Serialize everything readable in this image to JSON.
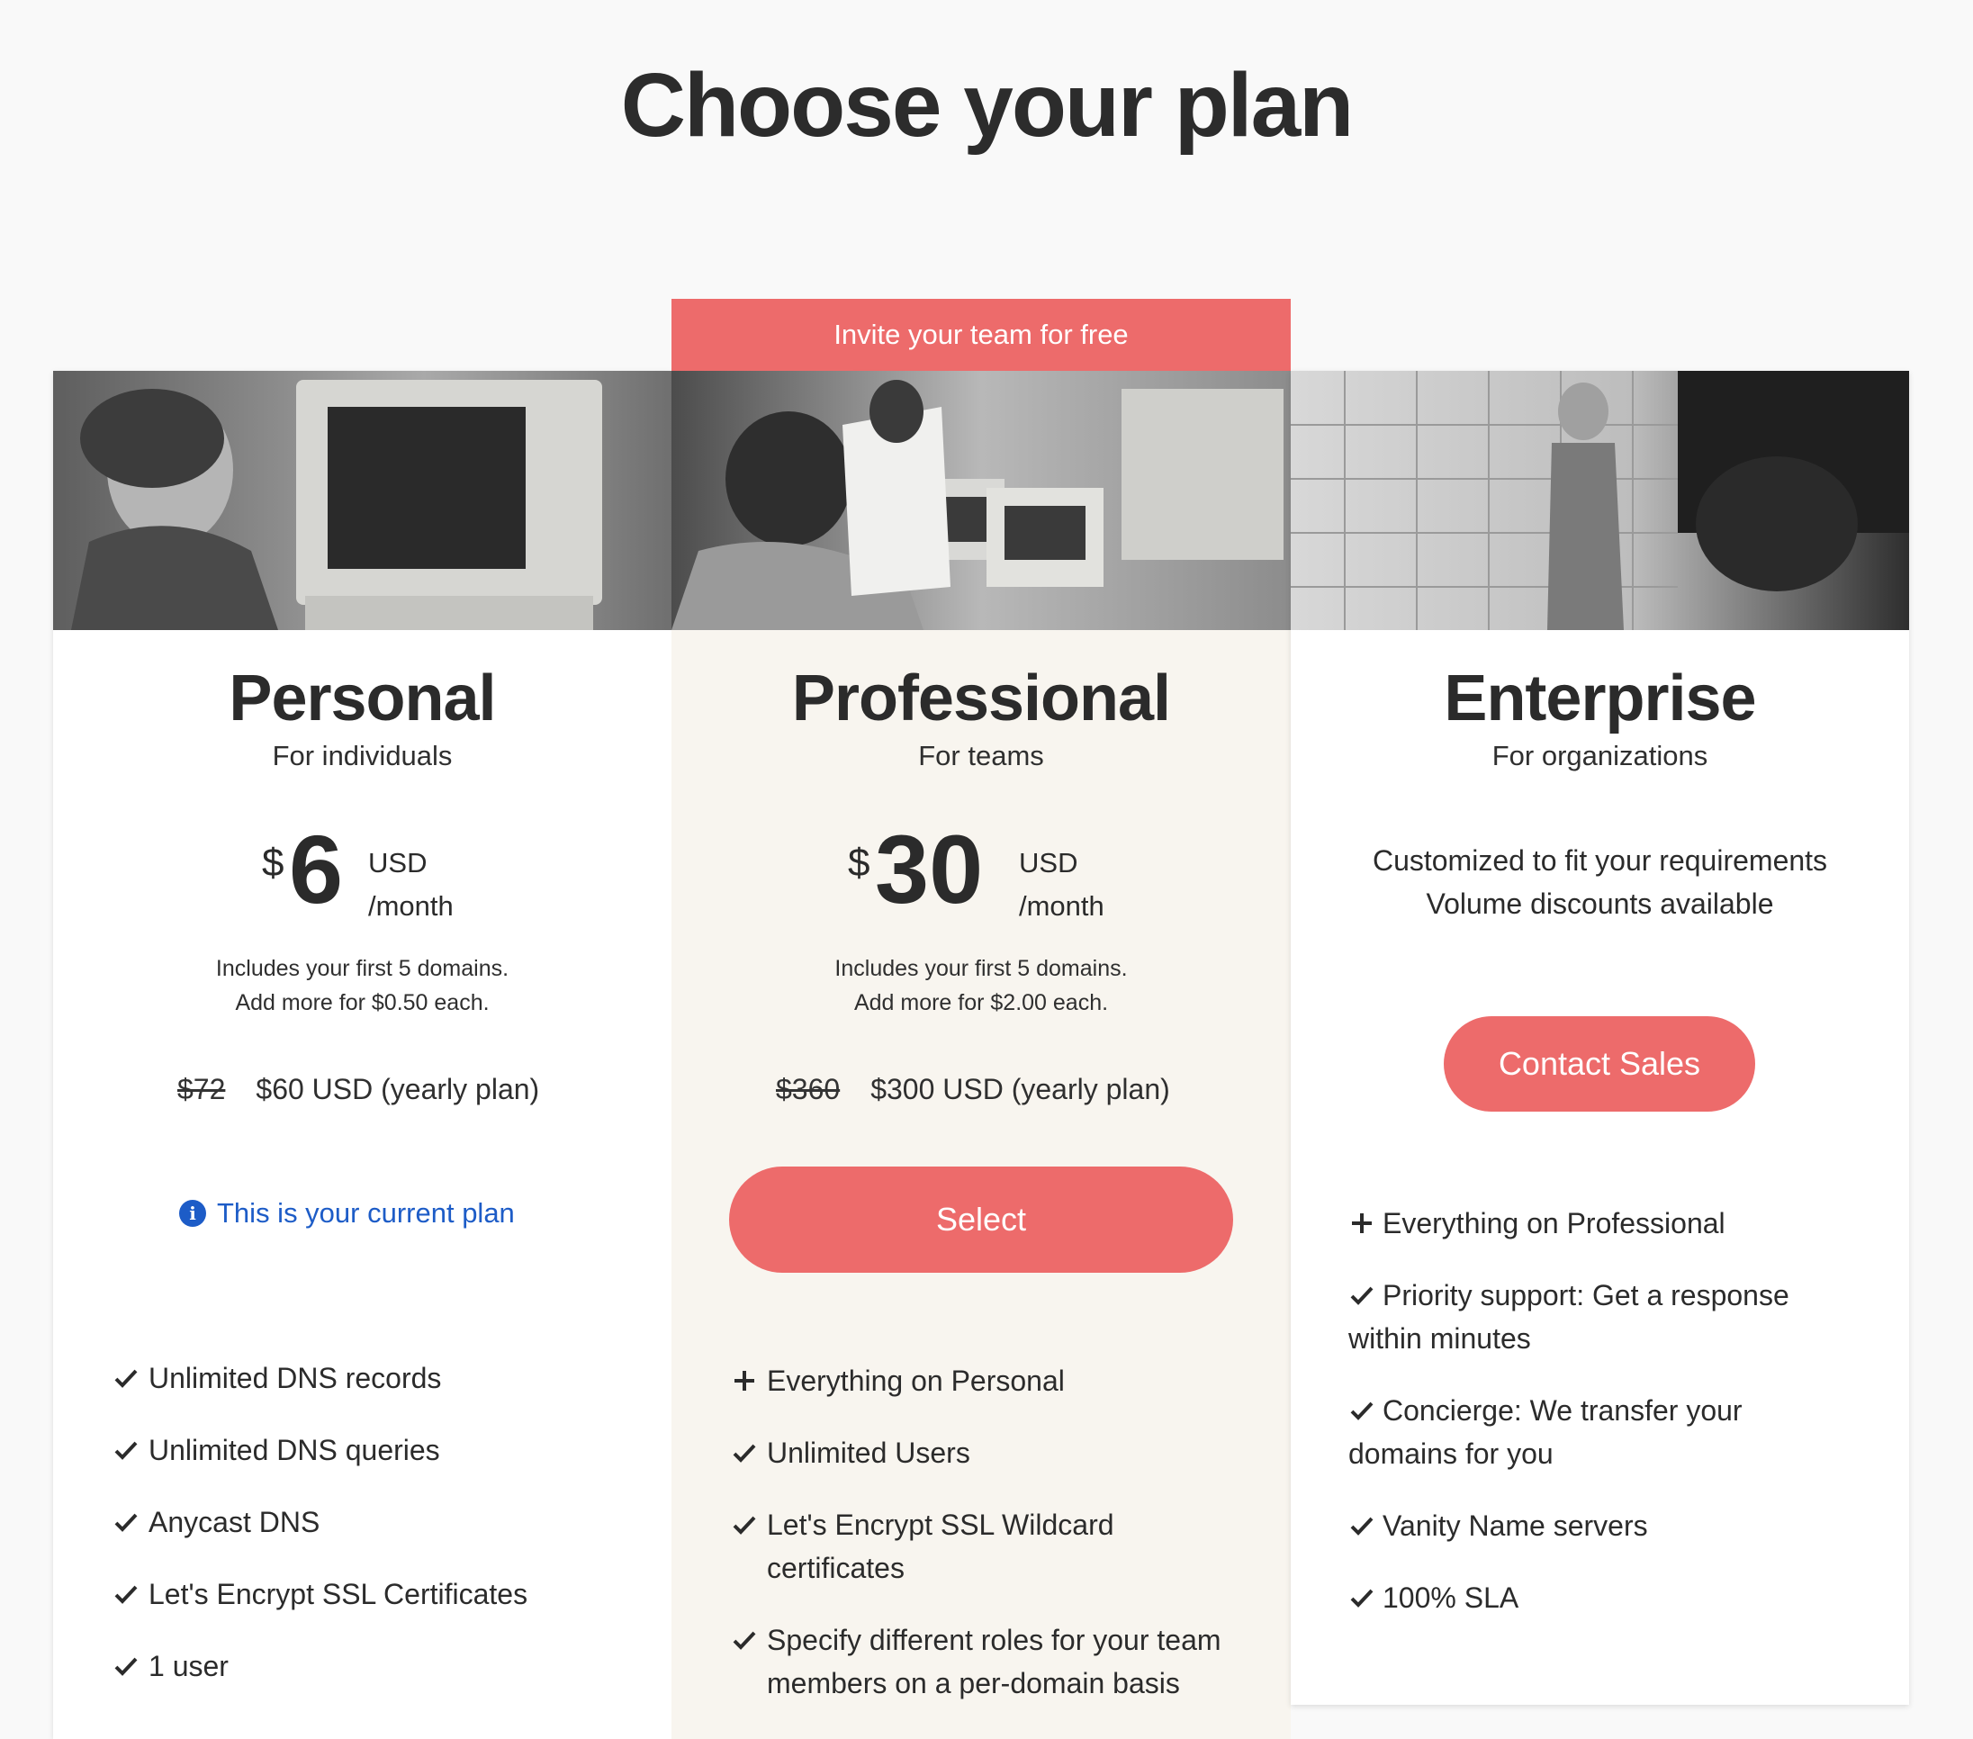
{
  "page": {
    "title": "Choose your plan"
  },
  "banner": {
    "text": "Invite your team for free"
  },
  "plans": {
    "personal": {
      "name": "Personal",
      "subtitle": "For individuals",
      "currency_symbol": "$",
      "price": "6",
      "price_unit_1": "USD",
      "price_unit_2": "/month",
      "includes_line_1": "Includes your first 5 domains.",
      "includes_line_2": "Add more for $0.50 each.",
      "old_yearly": "$72",
      "yearly": "$60 USD (yearly plan)",
      "current_plan_label": "This is your current plan",
      "features": [
        {
          "icon": "check-icon",
          "text": "Unlimited DNS records"
        },
        {
          "icon": "check-icon",
          "text": "Unlimited DNS queries"
        },
        {
          "icon": "check-icon",
          "text": "Anycast DNS"
        },
        {
          "icon": "check-icon",
          "text": "Let's Encrypt SSL Certificates"
        },
        {
          "icon": "check-icon",
          "text": "1 user"
        }
      ]
    },
    "professional": {
      "name": "Professional",
      "subtitle": "For teams",
      "currency_symbol": "$",
      "price": "30",
      "price_unit_1": "USD",
      "price_unit_2": "/month",
      "includes_line_1": "Includes your first 5 domains.",
      "includes_line_2": "Add more for $2.00 each.",
      "old_yearly": "$360",
      "yearly": "$300 USD (yearly plan)",
      "select_label": "Select",
      "features": [
        {
          "icon": "plus-icon",
          "text": "Everything on Personal"
        },
        {
          "icon": "check-icon",
          "text": "Unlimited Users"
        },
        {
          "icon": "check-icon",
          "text": "Let's Encrypt SSL Wildcard certificates"
        },
        {
          "icon": "check-icon",
          "text": "Specify different roles for your team members on a per-domain basis"
        }
      ]
    },
    "enterprise": {
      "name": "Enterprise",
      "subtitle": "For organizations",
      "custom_line_1": "Customized to fit your requirements",
      "custom_line_2": "Volume discounts available",
      "contact_label": "Contact Sales",
      "features": [
        {
          "icon": "plus-icon",
          "text": "Everything on Professional"
        },
        {
          "icon": "check-icon",
          "text": "Priority support: Get a response within minutes"
        },
        {
          "icon": "check-icon",
          "text": "Concierge: We transfer your domains for you"
        },
        {
          "icon": "check-icon",
          "text": "Vanity Name servers"
        },
        {
          "icon": "check-icon",
          "text": "100% SLA"
        }
      ]
    }
  },
  "colors": {
    "accent": "#ed6b6b",
    "link": "#1d5cc7",
    "professional_bg": "#f8f5ef",
    "page_bg": "#f9f9f9"
  }
}
